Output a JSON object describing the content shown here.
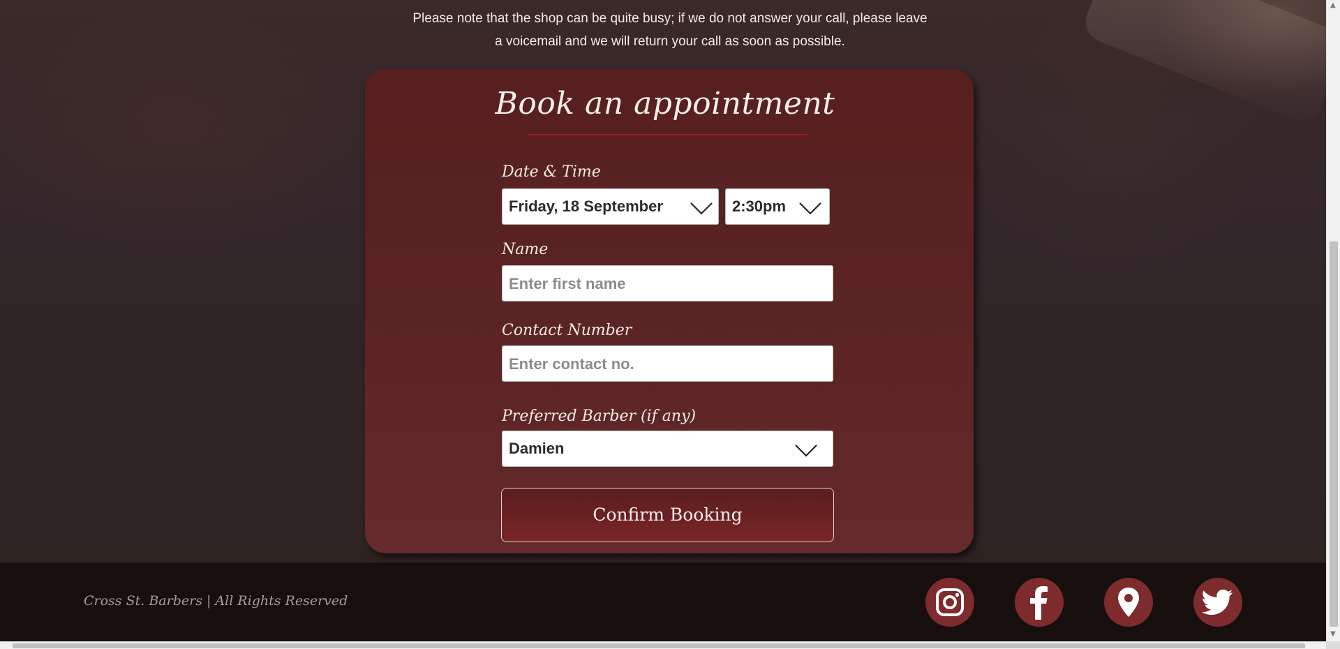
{
  "notice": {
    "line1": "Please note that the shop can be quite busy; if we do not answer your call, please leave",
    "line2": "a voicemail and we will return your call as soon as possible."
  },
  "booking": {
    "title": "Book an appointment",
    "datetime_label": "Date & Time",
    "date_value": "Friday, 18 September",
    "time_value": "2:30pm",
    "name_label": "Name",
    "name_placeholder": "Enter first name",
    "contact_label": "Contact Number",
    "contact_placeholder": "Enter contact no.",
    "barber_label": "Preferred Barber (if any)",
    "barber_value": "Damien",
    "confirm_label": "Confirm Booking"
  },
  "footer": {
    "copyright": "Cross St. Barbers | All Rights Reserved",
    "social_icons": [
      "instagram-icon",
      "facebook-icon",
      "map-pin-icon",
      "twitter-icon"
    ]
  },
  "colors": {
    "card": "#5a2324",
    "accent_rule": "#a0182a",
    "social_bg": "#7d2b2d",
    "footer_bg": "#170f0e"
  }
}
